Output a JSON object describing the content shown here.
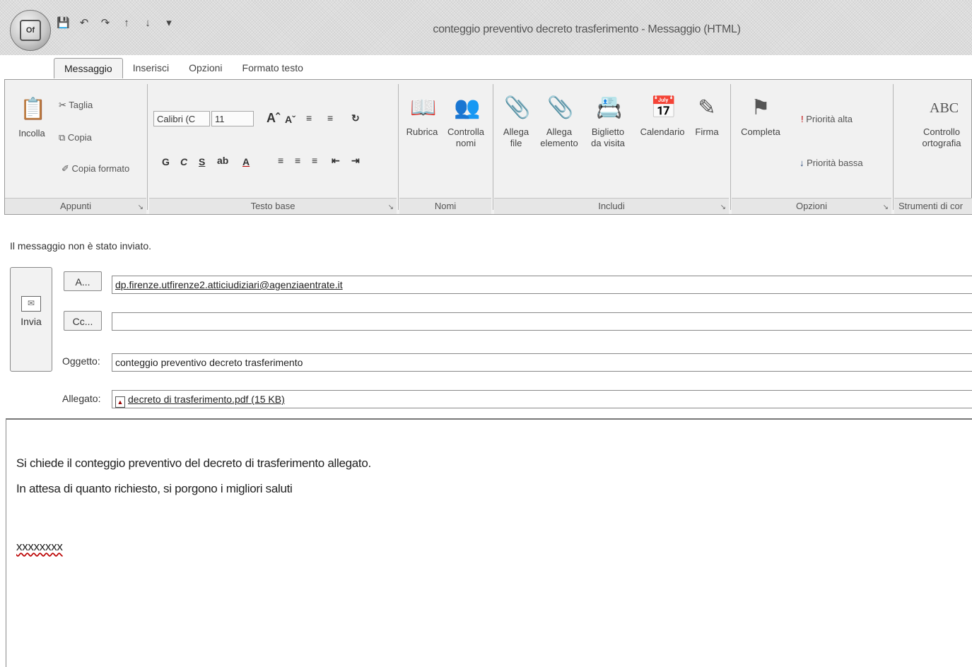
{
  "window": {
    "title": "conteggio preventivo decreto trasferimento - Messaggio (HTML)"
  },
  "qat": {
    "icons": [
      "save-icon",
      "undo-icon",
      "redo-icon",
      "up-arrow-icon",
      "down-arrow-icon",
      "customize-icon"
    ]
  },
  "tabs": [
    {
      "label": "Messaggio",
      "active": true
    },
    {
      "label": "Inserisci",
      "active": false
    },
    {
      "label": "Opzioni",
      "active": false
    },
    {
      "label": "Formato testo",
      "active": false
    }
  ],
  "ribbon": {
    "appunti": {
      "label": "Appunti",
      "incolla": "Incolla",
      "taglia": "Taglia",
      "copia": "Copia",
      "copia_formato": "Copia formato"
    },
    "testo_base": {
      "label": "Testo base",
      "font": "Calibri (C",
      "size": "11",
      "bold": "G",
      "italic": "C",
      "underline": "S"
    },
    "nomi": {
      "label": "Nomi",
      "rubrica": "Rubrica",
      "controlla_nomi_1": "Controlla",
      "controlla_nomi_2": "nomi"
    },
    "includi": {
      "label": "Includi",
      "allega_file_1": "Allega",
      "allega_file_2": "file",
      "allega_elemento_1": "Allega",
      "allega_elemento_2": "elemento",
      "biglietto_1": "Biglietto",
      "biglietto_2": "da visita",
      "calendario": "Calendario",
      "firma": "Firma"
    },
    "opzioni": {
      "label": "Opzioni",
      "completa": "Completa",
      "priorita_alta": "Priorità alta",
      "priorita_bassa": "Priorità bassa"
    },
    "strumenti": {
      "label": "Strumenti di cor",
      "controllo_1": "Controllo",
      "controllo_2": "ortografia",
      "abc": "ABC"
    }
  },
  "infobar": "Il messaggio non è stato inviato.",
  "header": {
    "send_label": "Invia",
    "to_button": "A...",
    "cc_button": "Cc...",
    "to_value": "dp.firenze.utfirenze2.atticiudiziari@agenziaentrate.it",
    "cc_value": "",
    "subject_label": "Oggetto:",
    "subject_value": "conteggio preventivo decreto trasferimento",
    "attachment_label": "Allegato:",
    "attachment_value": "decreto di trasferimento.pdf (15 KB)"
  },
  "body": {
    "line1": "Si chiede il conteggio preventivo del decreto di trasferimento allegato.",
    "line2": "In attesa di quanto richiesto, si porgono i migliori saluti",
    "signature": "xxxxxxxx"
  }
}
